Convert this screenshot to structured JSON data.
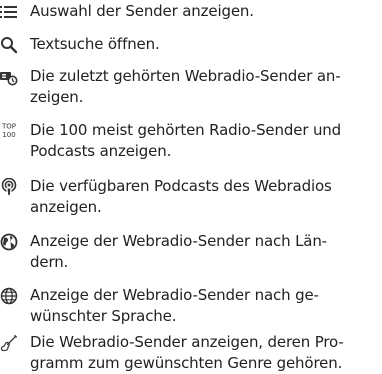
{
  "items": [
    {
      "icon": "list-icon",
      "text": "Auswahl der Sender anzeigen."
    },
    {
      "icon": "search-icon",
      "text": "Textsuche öffnen."
    },
    {
      "icon": "recent-history-icon",
      "text": "Die zuletzt gehörten Webradio-Sender an-\nzeigen."
    },
    {
      "icon": "top-100-icon",
      "top_label": "TOP",
      "bottom_label": "100",
      "text": "Die 100 meist gehörten Radio-Sender und\nPodcasts anzeigen."
    },
    {
      "icon": "podcast-icon",
      "text": "Die verfügbaren Podcasts des Webradios\nanzeigen."
    },
    {
      "icon": "globe-icon",
      "text": "Anzeige der Webradio-Sender nach Län-\ndern."
    },
    {
      "icon": "language-globe-icon",
      "text": "Anzeige der Webradio-Sender nach ge-\nwünschter Sprache."
    },
    {
      "icon": "guitar-icon",
      "text": "Die Webradio-Sender anzeigen, deren Pro-\ngramm zum gewünschten Genre gehören."
    }
  ]
}
